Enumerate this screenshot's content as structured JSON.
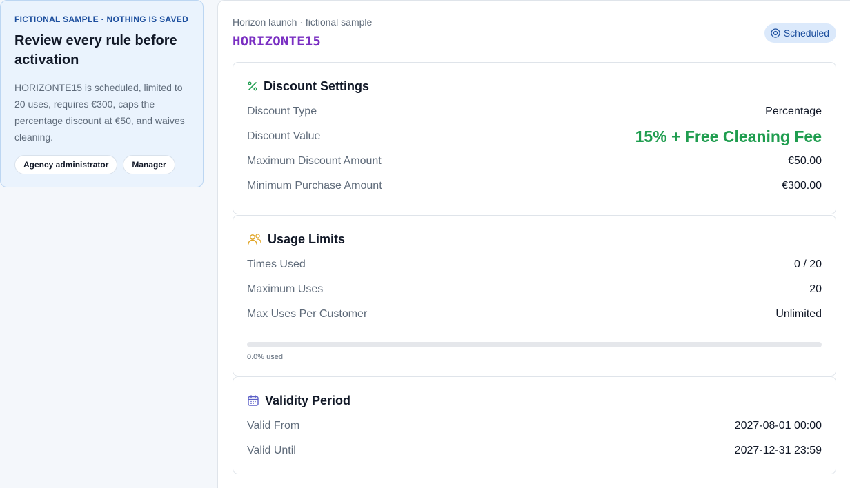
{
  "aside": {
    "eyebrow": "FICTIONAL SAMPLE · NOTHING IS SAVED",
    "title": "Review every rule before activation",
    "description": "HORIZONTE15 is scheduled, limited to 20 uses, requires €300, caps the percentage discount at €50, and waives cleaning.",
    "roles": [
      "Agency administrator",
      "Manager"
    ]
  },
  "header": {
    "kicker": "Horizon launch · fictional sample",
    "code": "HORIZONTE15",
    "status": "Scheduled",
    "status_icon": "target-circle-icon"
  },
  "colors": {
    "accent_code": "#7a2fc2",
    "success": "#1f9d4f",
    "status_bg": "#dbe9fb",
    "status_text": "#1d4f9e"
  },
  "discount": {
    "title": "Discount Settings",
    "icon": "percent-icon",
    "rows": [
      {
        "label": "Discount Type",
        "value": "Percentage"
      },
      {
        "label": "Discount Value",
        "value": "15% + Free Cleaning Fee"
      },
      {
        "label": "Maximum Discount Amount",
        "value": "€50.00"
      },
      {
        "label": "Minimum Purchase Amount",
        "value": "€300.00"
      }
    ]
  },
  "usage": {
    "title": "Usage Limits",
    "icon": "users-icon",
    "rows": [
      {
        "label": "Times Used",
        "value": "0 / 20"
      },
      {
        "label": "Maximum Uses",
        "value": "20"
      },
      {
        "label": "Max Uses Per Customer",
        "value": "Unlimited"
      }
    ],
    "progress_fraction": 0.0,
    "progress_label": "0.0% used"
  },
  "validity": {
    "title": "Validity Period",
    "icon": "calendar-icon",
    "rows": [
      {
        "label": "Valid From",
        "value": "2027-08-01 00:00"
      },
      {
        "label": "Valid Until",
        "value": "2027-12-31 23:59"
      }
    ]
  }
}
